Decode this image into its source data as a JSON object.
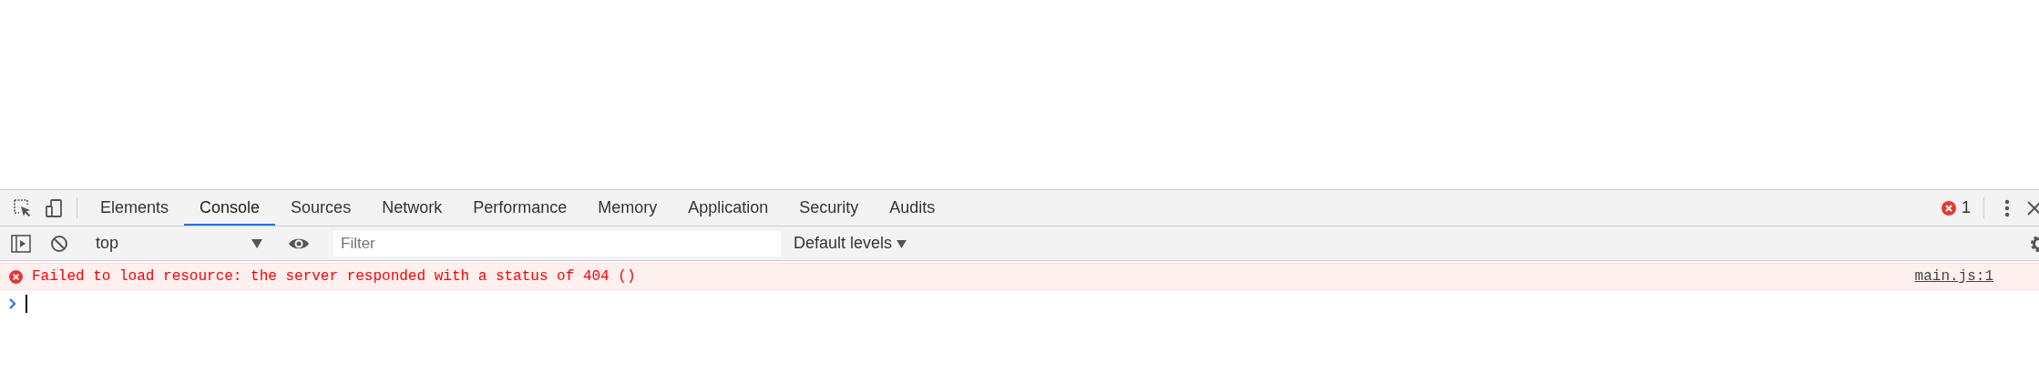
{
  "tabs": [
    {
      "label": "Elements",
      "selected": false
    },
    {
      "label": "Console",
      "selected": true
    },
    {
      "label": "Sources",
      "selected": false
    },
    {
      "label": "Network",
      "selected": false
    },
    {
      "label": "Performance",
      "selected": false
    },
    {
      "label": "Memory",
      "selected": false
    },
    {
      "label": "Application",
      "selected": false
    },
    {
      "label": "Security",
      "selected": false
    },
    {
      "label": "Audits",
      "selected": false
    }
  ],
  "error_count": "1",
  "toolbar": {
    "context": "top",
    "filter": {
      "placeholder": "Filter"
    },
    "levels": "Default levels"
  },
  "messages": [
    {
      "kind": "error",
      "text": "Failed to load resource: the server responded with a status of 404 ()",
      "source": "main.js:1"
    }
  ]
}
